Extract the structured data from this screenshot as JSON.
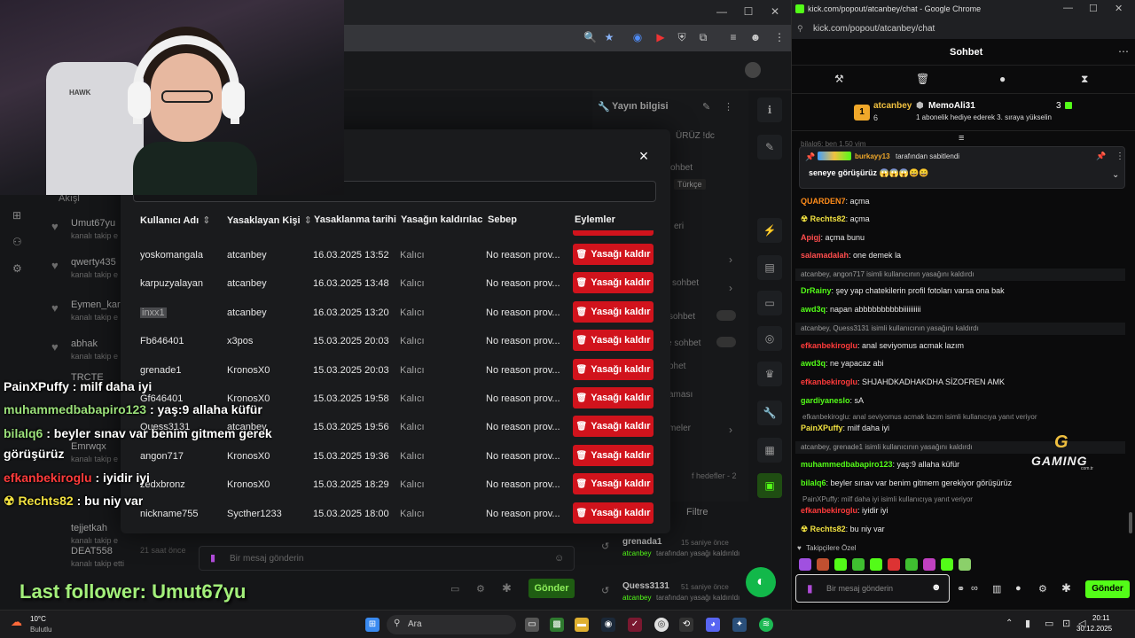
{
  "left_window": {
    "stream_info_title": "Yayın bilgisi",
    "stream_title_fragment": "ÜRÜZ !dc",
    "labels": [
      "ohbet",
      "Türkçe",
      "eri",
      "sohbet",
      "sohbet",
      "e sohbet",
      "bhet",
      "aması",
      "meler",
      "f hedefler - 2"
    ],
    "filter_label": "Filtre",
    "sidebar_heading": "Akışl",
    "sidebar_users": [
      {
        "name": "Umut67yu",
        "sub": "kanalı takip e"
      },
      {
        "name": "qwerty435",
        "sub": "kanalı takip e"
      },
      {
        "name": "Eymen_kar",
        "sub": "kanalı takip e"
      },
      {
        "name": "abhak",
        "sub": "kanalı takip e"
      },
      {
        "name": "TRCTE",
        "sub": ""
      },
      {
        "name": "Emrwqx",
        "sub": "kanalı takip e"
      },
      {
        "name": "tejjetkah",
        "sub": "kanalı takip e"
      },
      {
        "name": "DEAT558",
        "sub": "kanalı takip etti"
      }
    ],
    "activity": [
      {
        "name": "grenada1",
        "time": "15 saniye önce",
        "by": "atcanbey",
        "text": "tarafından yasağı kaldırıldı"
      },
      {
        "name": "Quess3131",
        "time": "51 saniye önce",
        "by": "atcanbey",
        "text": "tarafından yasağı kaldırıldı"
      }
    ],
    "sidebar_time": "21 saat önce",
    "chat_placeholder": "Bir mesaj gönderin",
    "send_label": "Gönder"
  },
  "ban_modal": {
    "close": "×",
    "headers": [
      "Kullanıcı Adı",
      "Yasaklayan Kişi",
      "Yasaklanma tarihi",
      "Yasağın kaldırılaca",
      "Sebep",
      "Eylemler"
    ],
    "unban_label": "Yasağı kaldır",
    "rows": [
      {
        "user": "yoskomangala",
        "by": "atcanbey",
        "date": "16.03.2025 13:52",
        "duration": "Kalıcı",
        "reason": "No reason prov..."
      },
      {
        "user": "karpuzyalayan",
        "by": "atcanbey",
        "date": "16.03.2025 13:48",
        "duration": "Kalıcı",
        "reason": "No reason prov..."
      },
      {
        "user": "inxx1",
        "by": "atcanbey",
        "date": "16.03.2025 13:20",
        "duration": "Kalıcı",
        "reason": "No reason prov..."
      },
      {
        "user": "Fb646401",
        "by": "x3pos",
        "date": "15.03.2025 20:03",
        "duration": "Kalıcı",
        "reason": "No reason prov..."
      },
      {
        "user": "grenade1",
        "by": "KronosX0",
        "date": "15.03.2025 20:03",
        "duration": "Kalıcı",
        "reason": "No reason prov..."
      },
      {
        "user": "Gf646401",
        "by": "KronosX0",
        "date": "15.03.2025 19:58",
        "duration": "Kalıcı",
        "reason": "No reason prov..."
      },
      {
        "user": "Quess3131",
        "by": "atcanbey",
        "date": "15.03.2025 19:56",
        "duration": "Kalıcı",
        "reason": "No reason prov..."
      },
      {
        "user": "angon717",
        "by": "KronosX0",
        "date": "15.03.2025 19:36",
        "duration": "Kalıcı",
        "reason": "No reason prov..."
      },
      {
        "user": "zedxbronz",
        "by": "KronosX0",
        "date": "15.03.2025 18:29",
        "duration": "Kalıcı",
        "reason": "No reason prov..."
      },
      {
        "user": "nickname755",
        "by": "Sycther1233",
        "date": "15.03.2025 18:00",
        "duration": "Kalıcı",
        "reason": "No reason prov..."
      }
    ]
  },
  "webcam": {
    "chair_logo": "HAWK"
  },
  "overlay_chat": [
    {
      "user": "PainXPuffy",
      "text": " : milf daha iyi",
      "color": "#ffffff"
    },
    {
      "user": "muhammedbabapiro123",
      "text": " : yaş:9 allaha küfür",
      "color": "#9be07a"
    },
    {
      "user": "bilalq6",
      "text": " : beyler sınav var benim gitmem gerek",
      "color": "#9be07a"
    },
    {
      "user": "görüşürüz",
      "text": "",
      "color": "#ffffff"
    },
    {
      "user": "efkanbekiroglu",
      "text": " : iyidir iyi",
      "color": "#ff3b3b"
    },
    {
      "user": "☢ Rechts82",
      "text": " : bu niy var",
      "color": "#f0e040"
    }
  ],
  "last_follower": "Last follower: Umut67yu",
  "chat_window": {
    "title": "kick.com/popout/atcanbey/chat - Google Chrome",
    "url": "kick.com/popout/atcanbey/chat",
    "header": "Sohbet",
    "gift": {
      "user1": "atcanbey",
      "user1_count": "6",
      "user2": "MemoAli31",
      "user2_count": "3",
      "text": "1 abonelik hediye ederek 3. sıraya yükselin"
    },
    "partial_top": "bilalq6: ben 1.50 yim",
    "pinned": {
      "by": "burkayy13",
      "by_text": "tarafından sabitlendi",
      "text": "seneye görüşürüz 😱😱😱😄😄"
    },
    "messages": [
      {
        "user": "QUARDEN7",
        "text": ": açma",
        "color": "#ff8c1a"
      },
      {
        "user": "☢ Rechts82",
        "text": ": açma",
        "color": "#f0e040"
      },
      {
        "user": "Apigj",
        "text": ": açma bunu",
        "color": "#ff4d4d"
      },
      {
        "user": "salamadalah",
        "text": ": one demek la",
        "color": "#ff4d4d"
      },
      {
        "sys": "atcanbey, angon717 isimli kullanıcının yasağını kaldırdı"
      },
      {
        "user": "DrRainy",
        "text": ": şey yap chatekilerin profil fotoları varsa ona bak",
        "color": "#53fc18"
      },
      {
        "user": "awd3q",
        "text": ": napan abbbbbbbbbbiiiiiiiiii",
        "color": "#53fc18"
      },
      {
        "sys": "atcanbey, Quess3131 isimli kullanıcının yasağını kaldırdı"
      },
      {
        "user": "efkanbekiroglu",
        "text": ": anal seviyomus acmak lazım",
        "color": "#ff3b3b"
      },
      {
        "user": "awd3q",
        "text": ": ne yapacaz abi",
        "color": "#53fc18"
      },
      {
        "user": "efkanbekiroglu",
        "text": ": SHJAHDKADHAKDHA SİZOFREN AMK",
        "color": "#ff3b3b"
      },
      {
        "user": "gardiyaneslo",
        "text": ": sA",
        "color": "#53fc18"
      },
      {
        "reply": "efkanbekiroglu: anal seviyomus acmak lazım isimli kullanıcıya yanıt veriyor"
      },
      {
        "user": "PainXPuffy",
        "text": ": milf daha iyi",
        "color": "#f0e040"
      },
      {
        "sys": "atcanbey, grenade1 isimli kullanıcının yasağını kaldırdı"
      },
      {
        "user": "muhammedbabapiro123",
        "text": ": yaş:9 allaha küfür",
        "color": "#53fc18"
      },
      {
        "user": "bilalq6",
        "text": ": beyler sınav var benim gitmem gerekiyor görüşürüz",
        "color": "#53fc18"
      },
      {
        "reply": "PainXPuffy: milf daha iyi isimli kullanıcıya yanıt veriyor"
      },
      {
        "user": "efkanbekiroglu",
        "text": ": iyidir iyi",
        "color": "#ff3b3b"
      },
      {
        "user": "☢ Rechts82",
        "text": ": bu niy var",
        "color": "#f0e040"
      }
    ],
    "followers_only": "Takipçilere Özel",
    "input_placeholder": "Bir mesaj gönderin",
    "send_label": "Gönder"
  },
  "gaming_logo": {
    "brand": "GAMING",
    "sub": "com.tr"
  },
  "taskbar": {
    "weather_temp": "10°C",
    "weather_desc": "Bulutlu",
    "search_label": "Ara",
    "time": "20:11",
    "date": "30.12.2025"
  }
}
